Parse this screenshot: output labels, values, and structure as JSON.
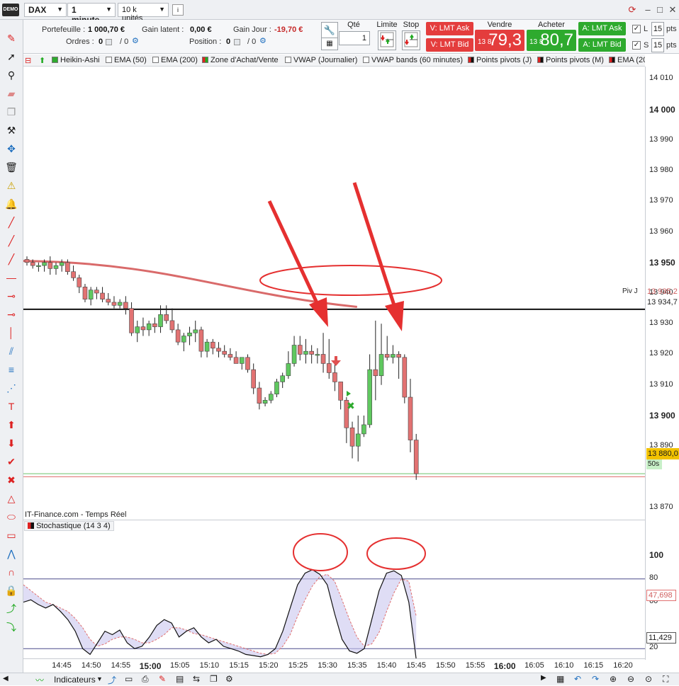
{
  "topbar": {
    "demo_badge": "DEMO",
    "instrument": "DAX",
    "timeframe": "1 minute",
    "size": "10 k unités",
    "refresh_icon": "refresh-icon"
  },
  "account": {
    "portefeuille_label": "Portefeuille :",
    "portefeuille_value": "1 000,70 €",
    "gain_latent_label": "Gain latent :",
    "gain_latent_value": "0,00 €",
    "gain_jour_label": "Gain Jour :",
    "gain_jour_value": "-19,70 €",
    "ordres_label": "Ordres :",
    "ordres_value": "0",
    "ordres_value2": "/ 0",
    "position_label": "Position :",
    "position_value": "0",
    "position_value2": "/ 0"
  },
  "order": {
    "qty_label": "Qté",
    "qty_value": "1",
    "limit_label": "Limite",
    "stop_label": "Stop",
    "sell_ask": "V: LMT Ask",
    "sell_bid": "V: LMT Bid",
    "sell_label": "Vendre",
    "sell_prefix": "13 8",
    "sell_price": "79,3",
    "buy_label": "Acheter",
    "buy_prefix": "13 8",
    "buy_price": "80,7",
    "buy_ask": "A: LMT Ask",
    "buy_bid": "A: LMT Bid",
    "l_label": "L",
    "l_value": "15",
    "s_label": "S",
    "s_value": "15",
    "pts": "pts"
  },
  "indicators": [
    {
      "label": "Heikin-Ashi",
      "color": "#2eaa2e"
    },
    {
      "label": "EMA (50)",
      "color": "#ffffff"
    },
    {
      "label": "EMA (200)",
      "color": "#ffffff"
    },
    {
      "label": "Zone d'Achat/Vente",
      "color": "#2eaa2e"
    },
    {
      "label": "VWAP (Journalier)",
      "color": "#ffffff"
    },
    {
      "label": "VWAP bands (60 minutes)",
      "color": "#ffffff"
    },
    {
      "label": "Points pivots (J)",
      "color": "#111111"
    },
    {
      "label": "Points pivots (M)",
      "color": "#111111"
    },
    {
      "label": "EMA (20",
      "color": "#111111"
    }
  ],
  "chart": {
    "source": "IT-Finance.com - Temps Réel",
    "pivot_label": "Piv J",
    "pivot_value": "13 935,2",
    "pivot_line_value": "13 934,7",
    "last_price": "13 880,0",
    "timer": "50s",
    "y_ticks": [
      "14 010",
      "14 000",
      "13 990",
      "13 980",
      "13 970",
      "13 960",
      "13 950",
      "13 940",
      "13 930",
      "13 920",
      "13 910",
      "13 900",
      "13 890",
      "13 870"
    ],
    "x_ticks": [
      "14:45",
      "14:50",
      "14:55",
      "15:00",
      "15:05",
      "15:10",
      "15:15",
      "15:20",
      "15:25",
      "15:30",
      "15:35",
      "15:40",
      "15:45",
      "15:50",
      "15:55",
      "16:00",
      "16:05",
      "16:10",
      "16:15",
      "16:20"
    ]
  },
  "stochastic": {
    "label": "Stochastique (14 3 4)",
    "y_ticks": [
      "100",
      "80",
      "60",
      "20"
    ],
    "value_d": "47,698",
    "value_k": "11,429"
  },
  "bottom": {
    "indicators_button": "Indicateurs"
  },
  "chart_data": {
    "type": "candlestick",
    "series": [
      {
        "name": "Heikin-Ashi",
        "ohlc": [
          [
            13951,
            13952,
            13949,
            13950
          ],
          [
            13950,
            13951,
            13948,
            13949
          ],
          [
            13949,
            13950,
            13947,
            13949
          ],
          [
            13949,
            13951,
            13947,
            13950
          ],
          [
            13950,
            13952,
            13946,
            13948
          ],
          [
            13948,
            13950,
            13946,
            13949
          ],
          [
            13949,
            13951,
            13947,
            13950
          ],
          [
            13950,
            13951,
            13946,
            13947
          ],
          [
            13947,
            13949,
            13944,
            13945
          ],
          [
            13945,
            13946,
            13940,
            13942
          ],
          [
            13942,
            13943,
            13937,
            13938
          ],
          [
            13938,
            13942,
            13936,
            13941
          ],
          [
            13941,
            13942,
            13938,
            13940
          ],
          [
            13940,
            13942,
            13937,
            13938
          ],
          [
            13938,
            13940,
            13936,
            13937
          ],
          [
            13937,
            13939,
            13935,
            13936
          ],
          [
            13936,
            13938,
            13935,
            13937
          ],
          [
            13937,
            13939,
            13933,
            13935
          ],
          [
            13935,
            13937,
            13926,
            13927
          ],
          [
            13927,
            13931,
            13924,
            13929
          ],
          [
            13929,
            13932,
            13926,
            13928
          ],
          [
            13928,
            13931,
            13926,
            13930
          ],
          [
            13930,
            13932,
            13927,
            13929
          ],
          [
            13929,
            13936,
            13927,
            13933
          ],
          [
            13933,
            13936,
            13930,
            13931
          ],
          [
            13931,
            13935,
            13927,
            13928
          ],
          [
            13928,
            13930,
            13923,
            13924
          ],
          [
            13924,
            13927,
            13921,
            13926
          ],
          [
            13926,
            13929,
            13923,
            13927
          ],
          [
            13927,
            13931,
            13924,
            13928
          ],
          [
            13928,
            13929,
            13919,
            13921
          ],
          [
            13921,
            13925,
            13919,
            13924
          ],
          [
            13924,
            13925,
            13920,
            13922
          ],
          [
            13922,
            13924,
            13919,
            13921
          ],
          [
            13921,
            13923,
            13919,
            13920
          ],
          [
            13920,
            13922,
            13918,
            13919
          ],
          [
            13919,
            13921,
            13917,
            13917
          ],
          [
            13917,
            13919,
            13915,
            13919
          ],
          [
            13919,
            13920,
            13914,
            13915
          ],
          [
            13915,
            13917,
            13907,
            13909
          ],
          [
            13909,
            13911,
            13902,
            13904
          ],
          [
            13904,
            13906,
            13903,
            13905
          ],
          [
            13905,
            13908,
            13904,
            13907
          ],
          [
            13907,
            13912,
            13906,
            13911
          ],
          [
            13911,
            13914,
            13909,
            13913
          ],
          [
            13913,
            13921,
            13912,
            13917
          ],
          [
            13917,
            13926,
            13916,
            13923
          ],
          [
            13923,
            13926,
            13918,
            13920
          ],
          [
            13920,
            13925,
            13917,
            13921
          ],
          [
            13921,
            13923,
            13917,
            13920
          ],
          [
            13920,
            13922,
            13917,
            13920
          ],
          [
            13920,
            13927,
            13914,
            13917
          ],
          [
            13917,
            13925,
            13912,
            13914
          ],
          [
            13914,
            13919,
            13908,
            13911
          ],
          [
            13911,
            13911,
            13902,
            13905
          ],
          [
            13905,
            13906,
            13891,
            13896
          ],
          [
            13896,
            13898,
            13886,
            13890
          ],
          [
            13890,
            13900,
            13885,
            13894
          ],
          [
            13894,
            13900,
            13893,
            13897
          ],
          [
            13897,
            13920,
            13896,
            13915
          ],
          [
            13915,
            13931,
            13905,
            13913
          ],
          [
            13913,
            13930,
            13910,
            13920
          ],
          [
            13920,
            13926,
            13918,
            13919
          ],
          [
            13919,
            13923,
            13917,
            13920
          ],
          [
            13920,
            13921,
            13912,
            13919
          ],
          [
            13919,
            13920,
            13904,
            13906
          ],
          [
            13906,
            13912,
            13888,
            13892
          ],
          [
            13892,
            13894,
            13879,
            13881
          ]
        ]
      },
      {
        "name": "EMA (200)",
        "x_label": [
          "14:40",
          "15:35"
        ],
        "values": [
          13950.5,
          13935.5
        ]
      }
    ],
    "ylim": [
      13866,
      14014
    ],
    "x_range": [
      "14:40",
      "16:25"
    ],
    "stochastic": {
      "ylim": [
        0,
        100
      ],
      "levels": [
        20,
        80
      ],
      "k": [
        60,
        62,
        58,
        55,
        58,
        52,
        45,
        35,
        20,
        15,
        25,
        35,
        32,
        36,
        25,
        20,
        22,
        30,
        40,
        45,
        42,
        30,
        35,
        38,
        30,
        25,
        28,
        22,
        20,
        18,
        15,
        14,
        13,
        15,
        20,
        35,
        55,
        75,
        85,
        88,
        84,
        75,
        50,
        28,
        18,
        16,
        20,
        45,
        70,
        85,
        87,
        83,
        60,
        11
      ],
      "d": [
        75,
        70,
        65,
        60,
        58,
        55,
        52,
        46,
        38,
        28,
        22,
        24,
        28,
        30,
        30,
        28,
        25,
        25,
        28,
        32,
        38,
        38,
        36,
        33,
        32,
        30,
        28,
        26,
        24,
        22,
        20,
        18,
        16,
        15,
        16,
        22,
        32,
        48,
        62,
        74,
        82,
        84,
        78,
        62,
        45,
        30,
        22,
        24,
        34,
        52,
        68,
        80,
        78,
        48
      ]
    }
  }
}
